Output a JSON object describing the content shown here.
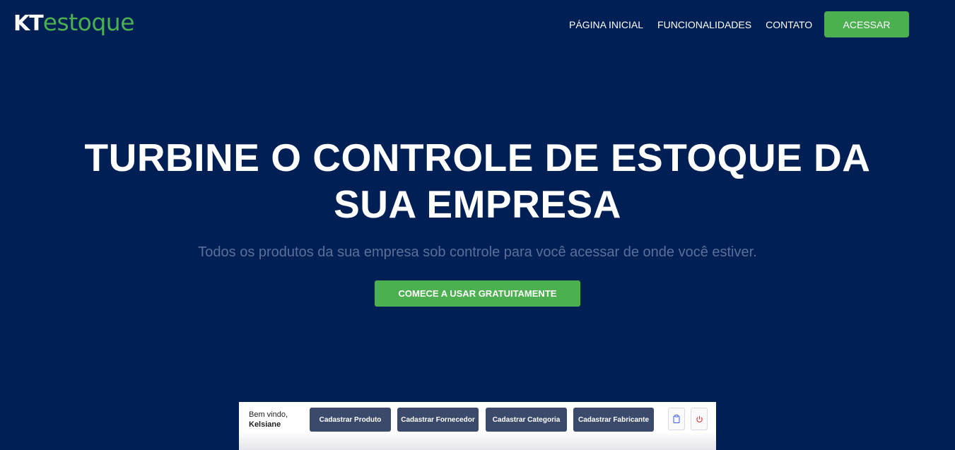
{
  "header": {
    "logo_kt": "KT",
    "logo_rest": "estoque",
    "nav": [
      "PÁGINA INICIAL",
      "FUNCIONALIDADES",
      "CONTATO"
    ],
    "access_button": "ACESSAR"
  },
  "hero": {
    "title_line1": "TURBINE O CONTROLE DE ESTOQUE DA",
    "title_line2": "SUA EMPRESA",
    "subtitle": "Todos os produtos da sua empresa sob controle para você acessar de onde você estiver.",
    "cta": "COMECE A USAR GRATUITAMENTE"
  },
  "preview": {
    "welcome": "Bem vindo,",
    "user": "Kelsiane",
    "buttons": [
      "Cadastrar Produto",
      "Cadastrar Fornecedor",
      "Cadastrar Categoria",
      "Cadastrar Fabricante"
    ],
    "icons": [
      "clipboard-icon",
      "power-icon"
    ]
  },
  "colors": {
    "background": "#001f54",
    "accent": "#4caf50",
    "preview_button": "#3b4a6b"
  }
}
